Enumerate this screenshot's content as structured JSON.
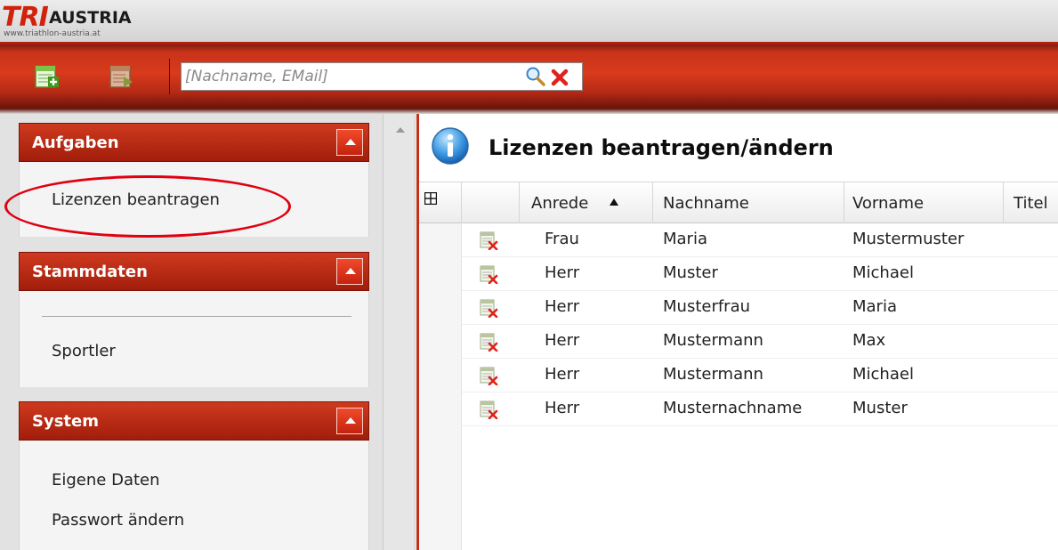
{
  "header": {
    "logo_main": "TRI",
    "logo_sub": "AUSTRIA",
    "logo_url": "www.triathlon-austria.at"
  },
  "toolbar": {
    "search_placeholder": "[Nachname, EMail]",
    "search_value": ""
  },
  "sidebar": {
    "panels": [
      {
        "title": "Aufgaben",
        "items": [
          "Lizenzen beantragen"
        ]
      },
      {
        "title": "Stammdaten",
        "items": [
          "Sportler"
        ]
      },
      {
        "title": "System",
        "items": [
          "Eigene Daten",
          "Passwort ändern"
        ]
      }
    ]
  },
  "content": {
    "title": "Lizenzen beantragen/ändern",
    "columns": [
      "Anrede",
      "Nachname",
      "Vorname",
      "Titel"
    ],
    "sorted_column": "Nachname",
    "sort_direction": "ascending",
    "rows": [
      [
        "Frau",
        "Maria",
        "Mustermuster"
      ],
      [
        "Herr",
        "Muster",
        "Michael"
      ],
      [
        "Herr",
        "Musterfrau",
        "Maria"
      ],
      [
        "Herr",
        "Mustermann",
        "Max"
      ],
      [
        "Herr",
        "Mustermann",
        "Michael"
      ],
      [
        "Herr",
        "Musternachname",
        "Muster"
      ]
    ]
  },
  "colors": {
    "brand_red": "#d2220b",
    "toolbar_red": "#c93319",
    "annotation_red": "#e00010"
  }
}
